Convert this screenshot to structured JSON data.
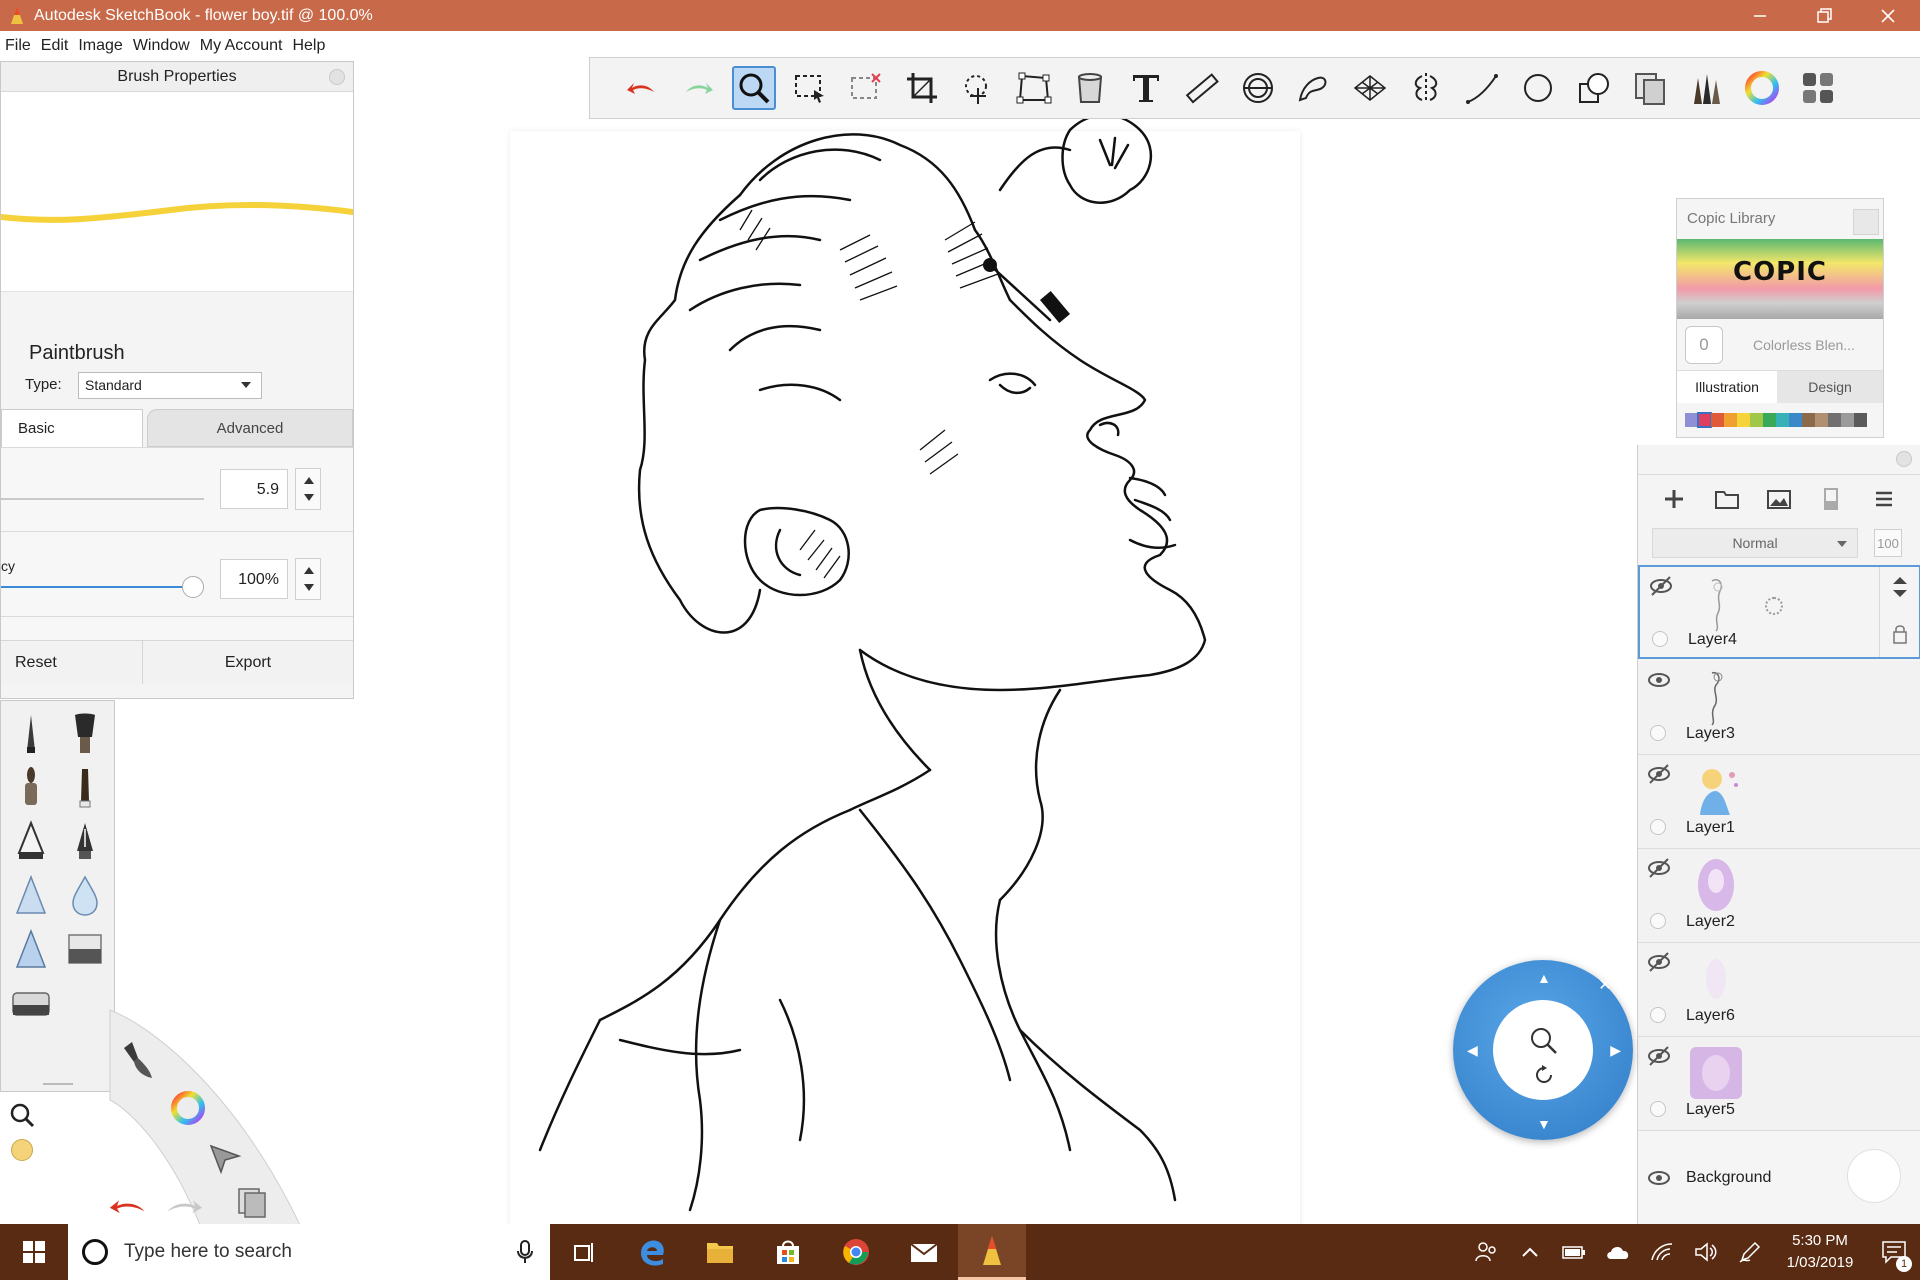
{
  "window": {
    "title": "Autodesk SketchBook - flower boy.tif @ 100.0%"
  },
  "menubar": {
    "items": [
      "File",
      "Edit",
      "Image",
      "Window",
      "My Account",
      "Help"
    ]
  },
  "toolbar": {
    "tools": [
      {
        "name": "undo-icon",
        "active": false
      },
      {
        "name": "redo-icon",
        "active": false
      },
      {
        "name": "zoom-icon",
        "active": true
      },
      {
        "name": "selection-icon",
        "active": false
      },
      {
        "name": "deselect-icon",
        "active": false
      },
      {
        "name": "crop-icon",
        "active": false
      },
      {
        "name": "transform-icon",
        "active": false
      },
      {
        "name": "distort-icon",
        "active": false
      },
      {
        "name": "fill-icon",
        "active": false
      },
      {
        "name": "text-icon",
        "active": false
      },
      {
        "name": "ruler-icon",
        "active": false
      },
      {
        "name": "ellipse-guide-icon",
        "active": false
      },
      {
        "name": "french-curve-icon",
        "active": false
      },
      {
        "name": "perspective-icon",
        "active": false
      },
      {
        "name": "symmetry-icon",
        "active": false
      },
      {
        "name": "line-icon",
        "active": false
      },
      {
        "name": "ellipse-icon",
        "active": false
      },
      {
        "name": "shape-icon",
        "active": false
      },
      {
        "name": "copy-paste-icon",
        "active": false
      },
      {
        "name": "brush-library-icon",
        "active": false
      },
      {
        "name": "color-wheel-icon",
        "active": false
      },
      {
        "name": "layout-icon",
        "active": false
      }
    ]
  },
  "brush_properties": {
    "title": "Brush Properties",
    "brush_name": "Paintbrush",
    "type_label": "Type:",
    "type_value": "Standard",
    "tabs": {
      "basic": "Basic",
      "advanced": "Advanced"
    },
    "size_value": "5.9",
    "opacity_label": "cy",
    "opacity_value": "100%",
    "opacity_level": 1.0,
    "reset_label": "Reset",
    "export_label": "Export",
    "preview_color": "#f5d13a"
  },
  "copic_library": {
    "title": "Copic Library",
    "logo_text": "COPIC",
    "blend_number": "0",
    "blend_label": "Colorless Blen...",
    "tabs": {
      "illustration": "Illustration",
      "design": "Design"
    },
    "swatches": [
      "#8f8fd6",
      "#e04060",
      "#e05a3a",
      "#f0a030",
      "#f4d43a",
      "#a0c848",
      "#3aaa5a",
      "#38b0b8",
      "#3a88c8",
      "#8a6a4a",
      "#b09070",
      "#707070",
      "#9a9a9a",
      "#5a5a5a"
    ]
  },
  "layers": {
    "blend_mode": "Normal",
    "opacity": "100",
    "items": [
      {
        "name": "Layer4",
        "visible": false,
        "selected": true
      },
      {
        "name": "Layer3",
        "visible": true,
        "selected": false
      },
      {
        "name": "Layer1",
        "visible": false,
        "selected": false
      },
      {
        "name": "Layer2",
        "visible": false,
        "selected": false
      },
      {
        "name": "Layer6",
        "visible": false,
        "selected": false
      },
      {
        "name": "Layer5",
        "visible": false,
        "selected": false
      }
    ],
    "background_label": "Background"
  },
  "taskbar": {
    "search_placeholder": "Type here to search",
    "time": "5:30 PM",
    "date": "1/03/2019",
    "notification_count": "1"
  },
  "colors": {
    "titlebar": "#c8694a",
    "taskbar": "#5a2b13",
    "selection": "#5d9ad8",
    "puck": "#3a8ad6"
  }
}
